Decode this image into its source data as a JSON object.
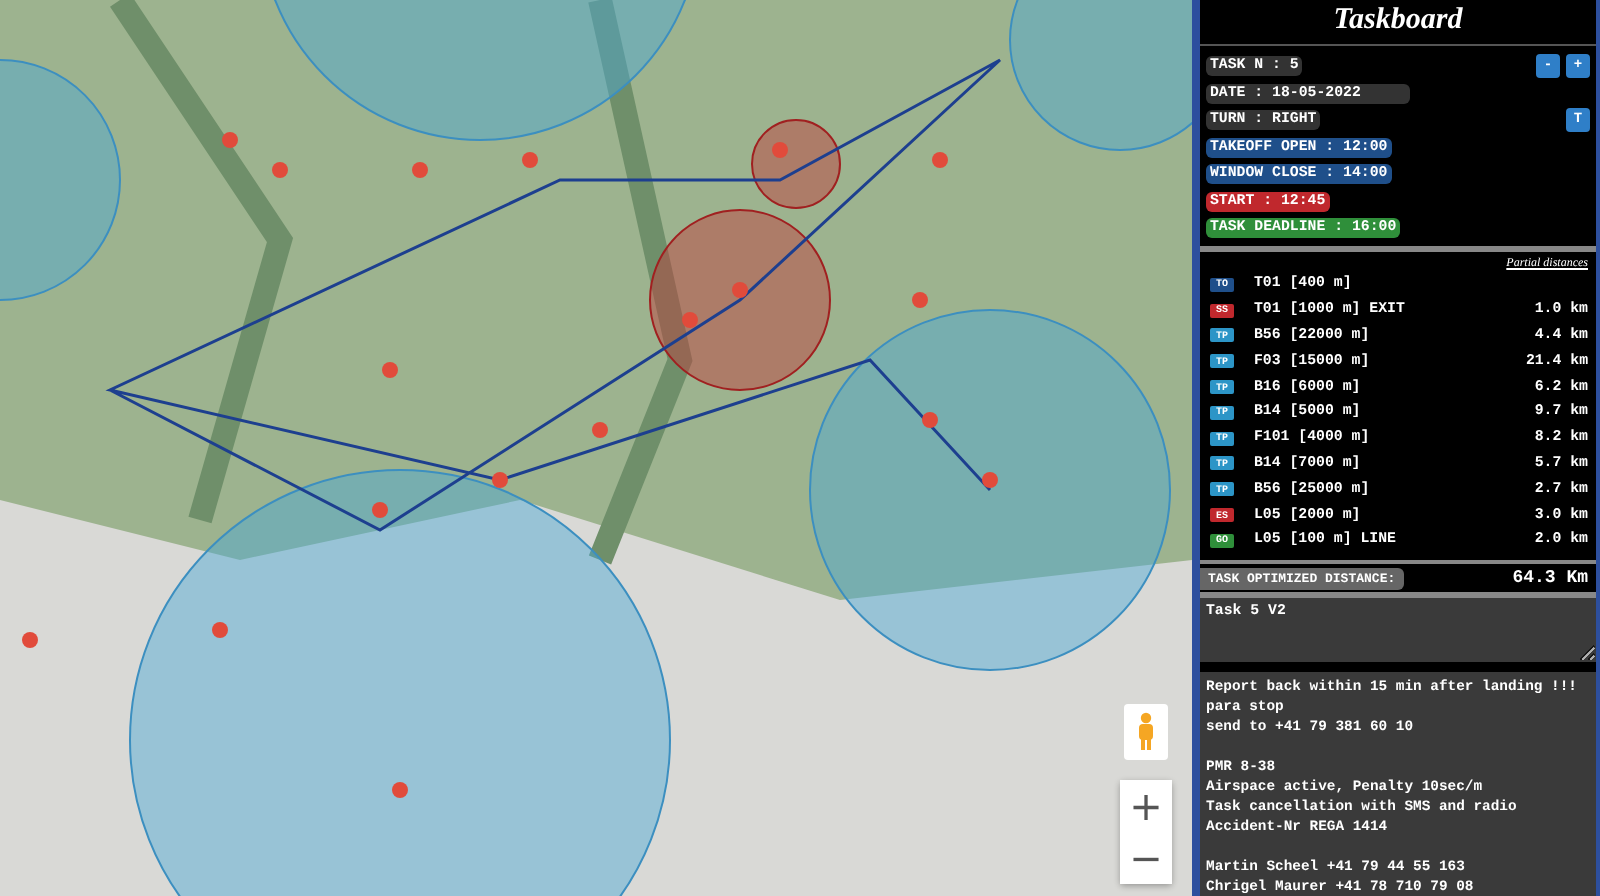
{
  "map": {
    "controls": {
      "zoom_in": "+",
      "zoom_out": "−"
    }
  },
  "taskboard": {
    "title": "Taskboard",
    "task_number": "TASK N : 5",
    "step_buttons": [
      "-",
      "+"
    ],
    "date": {
      "label": "DATE : ",
      "value": "18-05-2022"
    },
    "turn": "TURN : RIGHT",
    "turn_button": "T",
    "times": [
      {
        "text": "TAKEOFF OPEN : 12:00",
        "color": "#1f4f8a"
      },
      {
        "text": "WINDOW CLOSE : 14:00",
        "color": "#1f4f8a"
      },
      {
        "text": "START : 12:45",
        "color": "#c0282d"
      },
      {
        "text": "TASK DEADLINE : 16:00",
        "color": "#2f8f3a"
      }
    ],
    "partial_label": "Partial distances",
    "turnpoints": [
      {
        "kind": "takeoff",
        "badge": "TO",
        "name": "T01 [400 m]"
      },
      {
        "kind": "start",
        "badge": "SS",
        "name": "T01 [1000 m] EXIT",
        "distance": "1.0 km"
      },
      {
        "kind": "turnpoint",
        "badge": "TP",
        "name": "B56 [22000 m]",
        "distance": "4.4 km"
      },
      {
        "kind": "turnpoint",
        "badge": "TP",
        "name": "F03 [15000 m]",
        "distance": "21.4 km"
      },
      {
        "kind": "turnpoint",
        "badge": "TP",
        "name": "B16 [6000 m]",
        "distance": "6.2 km"
      },
      {
        "kind": "turnpoint",
        "badge": "TP",
        "name": "B14 [5000 m]",
        "distance": "9.7 km"
      },
      {
        "kind": "turnpoint",
        "badge": "TP",
        "name": "F101 [4000 m]",
        "distance": "8.2 km"
      },
      {
        "kind": "turnpoint",
        "badge": "TP",
        "name": "B14 [7000 m]",
        "distance": "5.7 km"
      },
      {
        "kind": "turnpoint",
        "badge": "TP",
        "name": "B56 [25000 m]",
        "distance": "2.7 km"
      },
      {
        "kind": "end",
        "badge": "ES",
        "name": "L05 [2000 m]",
        "distance": "3.0 km"
      },
      {
        "kind": "goal",
        "badge": "GO",
        "name": "L05 [100 m] LINE",
        "distance": "2.0 km"
      }
    ],
    "total": {
      "label": "TASK OPTIMIZED DISTANCE:",
      "value": "64.3 Km"
    },
    "comment": {
      "value": "Task 5 V2"
    },
    "notes": [
      [
        "Report back within 15 min after landing !!!",
        "para stop",
        "send to +41 79 381 60 10"
      ],
      [
        "PMR 8-38",
        "Airspace active, Penalty 10sec/m",
        "Task cancellation with SMS and radio",
        "Accident-Nr REGA 1414"
      ],
      [
        "Martin Scheel +41 79 44 55 163",
        "Chrigel Maurer +41 78 710 79 08"
      ]
    ]
  }
}
